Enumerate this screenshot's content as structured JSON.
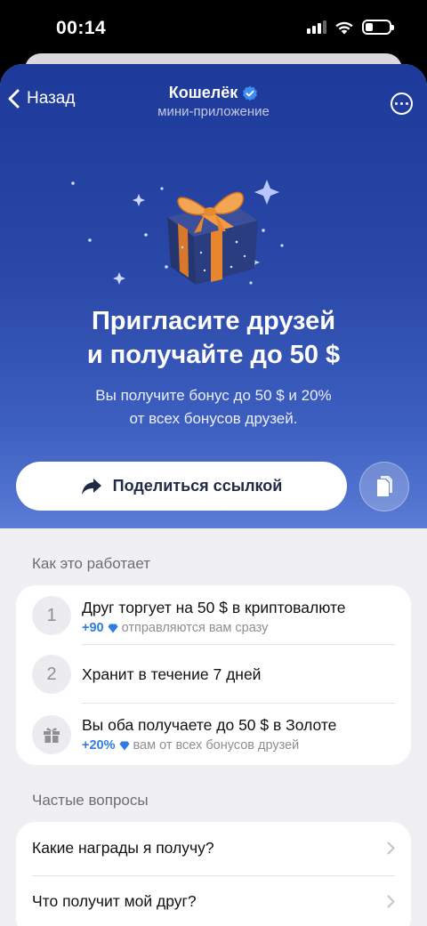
{
  "status_bar": {
    "time": "00:14"
  },
  "header": {
    "back_label": "Назад",
    "title": "Кошелёк",
    "subtitle": "мини-приложение"
  },
  "hero": {
    "headline_line1": "Пригласите друзей",
    "headline_line2": "и получайте до 50 $",
    "subtext_line1": "Вы получите бонус до 50 $ и 20%",
    "subtext_line2": "от всех бонусов друзей.",
    "share_label": "Поделиться ссылкой"
  },
  "how_it_works": {
    "title": "Как это работает",
    "steps": [
      {
        "badge": "1",
        "title": "Друг торгует на 50 $ в криптовалюте",
        "accent": "+90",
        "note": "отправляются вам сразу"
      },
      {
        "badge": "2",
        "title": "Хранит в течение 7 дней"
      },
      {
        "badge": "gift-icon",
        "title": "Вы оба получаете до 50 $ в Золоте",
        "accent": "+20%",
        "note": "вам от всех бонусов друзей"
      }
    ]
  },
  "faq": {
    "title": "Частые вопросы",
    "items": [
      {
        "label": "Какие награды я получу?"
      },
      {
        "label": "Что получит мой друг?"
      }
    ]
  },
  "colors": {
    "hero_top": "#1d3a9a",
    "hero_bottom": "#5a7cd6",
    "accent_blue": "#2f7de1",
    "verified": "#3d8df5",
    "gift_ribbon": "#f0953a",
    "gift_box": "#2a3b7a"
  },
  "icons": [
    "back-chevron-icon",
    "verified-icon",
    "more-icon",
    "share-arrow-icon",
    "copy-icon",
    "gem-icon",
    "gift-icon",
    "chevron-right-icon"
  ]
}
